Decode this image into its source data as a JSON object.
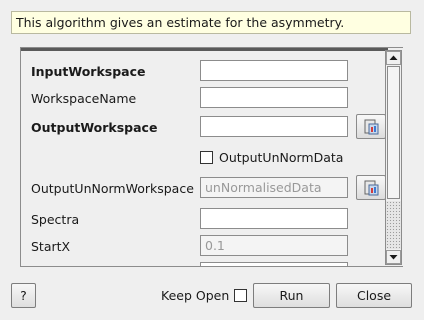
{
  "description": "This algorithm gives an estimate for the asymmetry.",
  "properties": [
    {
      "label": "InputWorkspace",
      "bold": true,
      "value": "",
      "readonly": false,
      "browse": false
    },
    {
      "label": "WorkspaceName",
      "bold": false,
      "value": "",
      "readonly": false,
      "browse": false
    },
    {
      "label": "OutputWorkspace",
      "bold": true,
      "value": "",
      "readonly": false,
      "browse": true
    },
    {
      "checkbox_label": "OutputUnNormData",
      "checked": false
    },
    {
      "label": "OutputUnNormWorkspace",
      "bold": false,
      "value": "unNormalisedData",
      "readonly": true,
      "browse": true
    },
    {
      "label": "Spectra",
      "bold": false,
      "value": "",
      "readonly": false,
      "browse": false
    },
    {
      "label": "StartX",
      "bold": false,
      "value": "0.1",
      "readonly": true,
      "browse": false
    }
  ],
  "footer": {
    "help_label": "?",
    "keep_open_label": "Keep Open",
    "keep_open_checked": false,
    "run_label": "Run",
    "close_label": "Close"
  },
  "icons": {
    "browse": "workspace-browse-icon",
    "scroll_up": "arrow-up-icon",
    "scroll_down": "arrow-down-icon"
  }
}
